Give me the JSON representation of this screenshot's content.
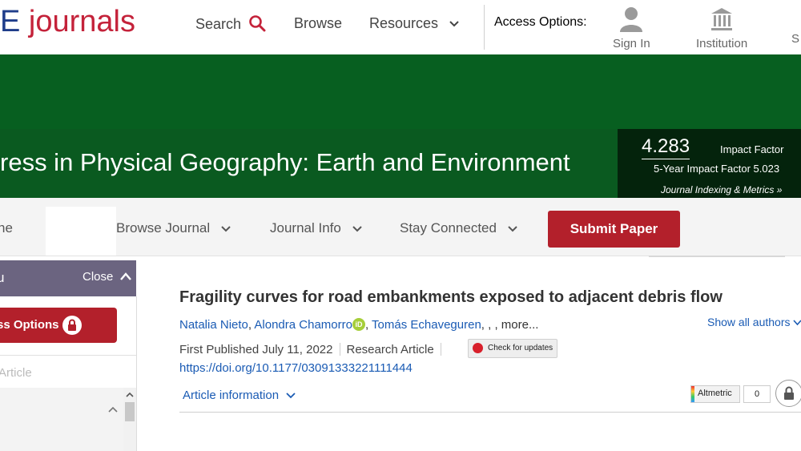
{
  "header": {
    "logo_left": "E",
    "logo_right": "journals",
    "nav": {
      "search": "Search",
      "browse": "Browse",
      "resources": "Resources"
    },
    "access_options": "Access Options:",
    "access_items": {
      "sign_in": "Sign In",
      "institution": "Institution",
      "partial": "S"
    }
  },
  "banner": {
    "journal_title": "ress in Physical Geography: Earth and Environment",
    "impact_factor": "4.283",
    "impact_factor_label": "Impact Factor",
    "five_year": "5-Year Impact Factor 5.023",
    "indexing_link": "Journal Indexing & Metrics »"
  },
  "subnav": {
    "home_partial": "ne",
    "browse_journal": "Browse Journal",
    "journal_info": "Journal Info",
    "stay_connected": "Stay Connected",
    "submit_paper": "Submit Paper"
  },
  "sidebar": {
    "menu_partial": "u",
    "close": "Close",
    "access_button": "ss Options",
    "article_partial": "Article"
  },
  "article": {
    "title": "Fragility curves for road embankments exposed to adjacent debris flow",
    "authors": [
      "Natalia Nieto",
      "Alondra Chamorro",
      "Tomás Echaveguren"
    ],
    "author_sep_1": ",",
    "author_sep_2": ",",
    "authors_tail": ", , , more...",
    "orcid_label": "iD",
    "show_all": "Show all authors",
    "first_published": "First Published July 11, 2022",
    "article_type": "Research Article",
    "check_updates": "Check for updates",
    "doi": "https://doi.org/10.1177/03091333221111444",
    "article_info": "Article information",
    "altmetric_label": "Altmetric",
    "altmetric_count": "0"
  },
  "colors": {
    "green_banner": "#075f20",
    "submit_red": "#b3202b",
    "link_blue": "#1a5bb4",
    "sidebar_purple": "#6b6480"
  }
}
